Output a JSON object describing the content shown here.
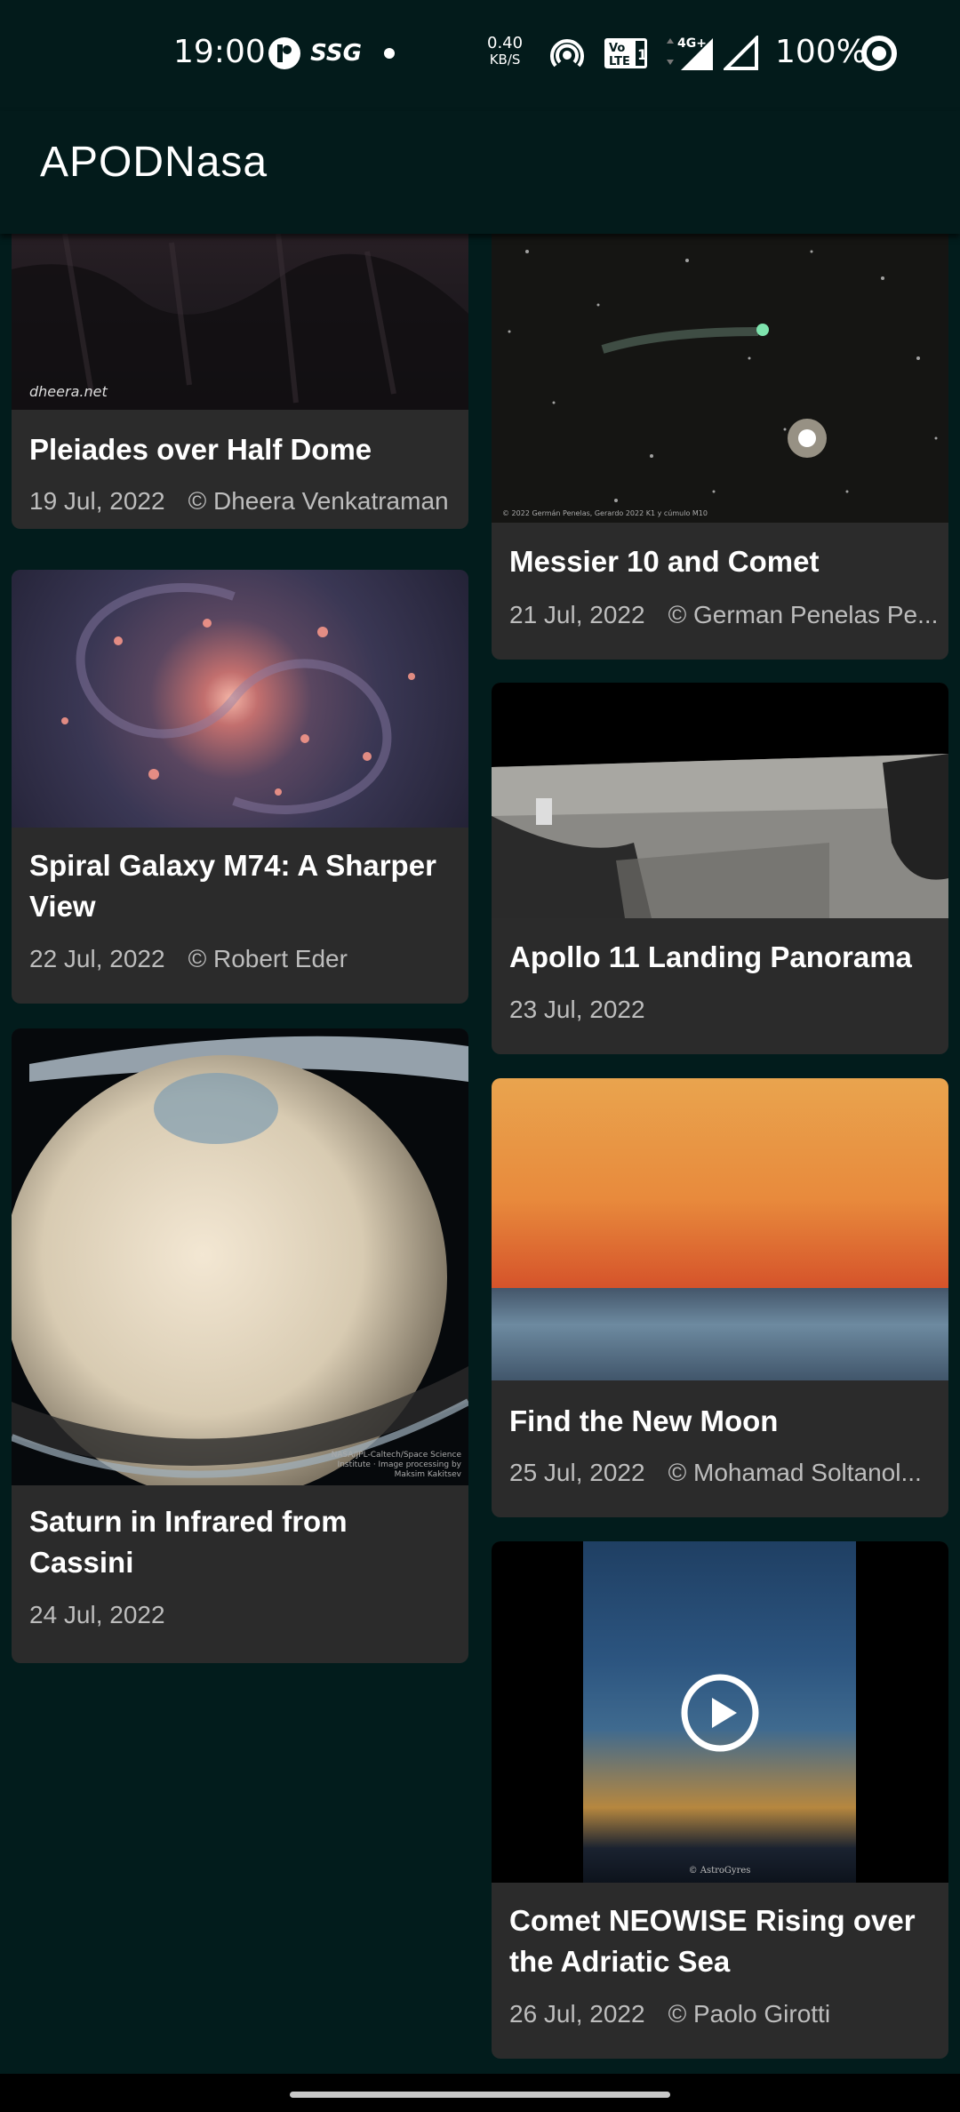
{
  "status_bar": {
    "time": "19:00",
    "net_speed_value": "0.40",
    "net_speed_unit": "KB/S",
    "network": "4G+",
    "volte": "Vo LTE 1",
    "battery": "100%",
    "icons": [
      "app-notification-icon",
      "ssg-icon",
      "dot-icon",
      "hotspot-icon",
      "volte-icon",
      "signal-4g-icon",
      "signal-icon",
      "battery-ring-icon"
    ]
  },
  "app_bar": {
    "title": "APODNasa"
  },
  "cards": [
    {
      "title": "Pleiades over Half Dome",
      "date": "19 Jul, 2022",
      "credit": "© Dheera Venkatraman",
      "image": "half-dome-night-image",
      "watermark": "dheera.net"
    },
    {
      "title": "Messier 10 and Comet",
      "date": "21 Jul, 2022",
      "credit": "© German Penelas Pe...",
      "image": "comet-starfield-image",
      "watermark": "© 2022 Germán Penelas, Gerardo 2022 K1 y cúmulo M10"
    },
    {
      "title": "Spiral Galaxy M74: A Sharper View",
      "date": "22 Jul, 2022",
      "credit": "© Robert Eder",
      "image": "spiral-galaxy-image"
    },
    {
      "title": "Apollo 11 Landing Panorama",
      "date": "23 Jul, 2022",
      "credit": "",
      "image": "moon-panorama-image"
    },
    {
      "title": "Saturn in Infrared from Cassini",
      "date": "24 Jul, 2022",
      "credit": "",
      "image": "saturn-image",
      "watermark": "NASA/JPL-Caltech/Space Science Institute · Image processing by Maksim Kakitsev"
    },
    {
      "title": "Find the New Moon",
      "date": "25 Jul, 2022",
      "credit": "© Mohamad Soltanol...",
      "image": "sunset-sea-image"
    },
    {
      "title": "Comet NEOWISE Rising over the Adriatic Sea",
      "date": "26 Jul, 2022",
      "credit": "© Paolo Girotti",
      "image": "comet-adriatic-video-thumbnail",
      "watermark": "© AstroGyres"
    }
  ]
}
